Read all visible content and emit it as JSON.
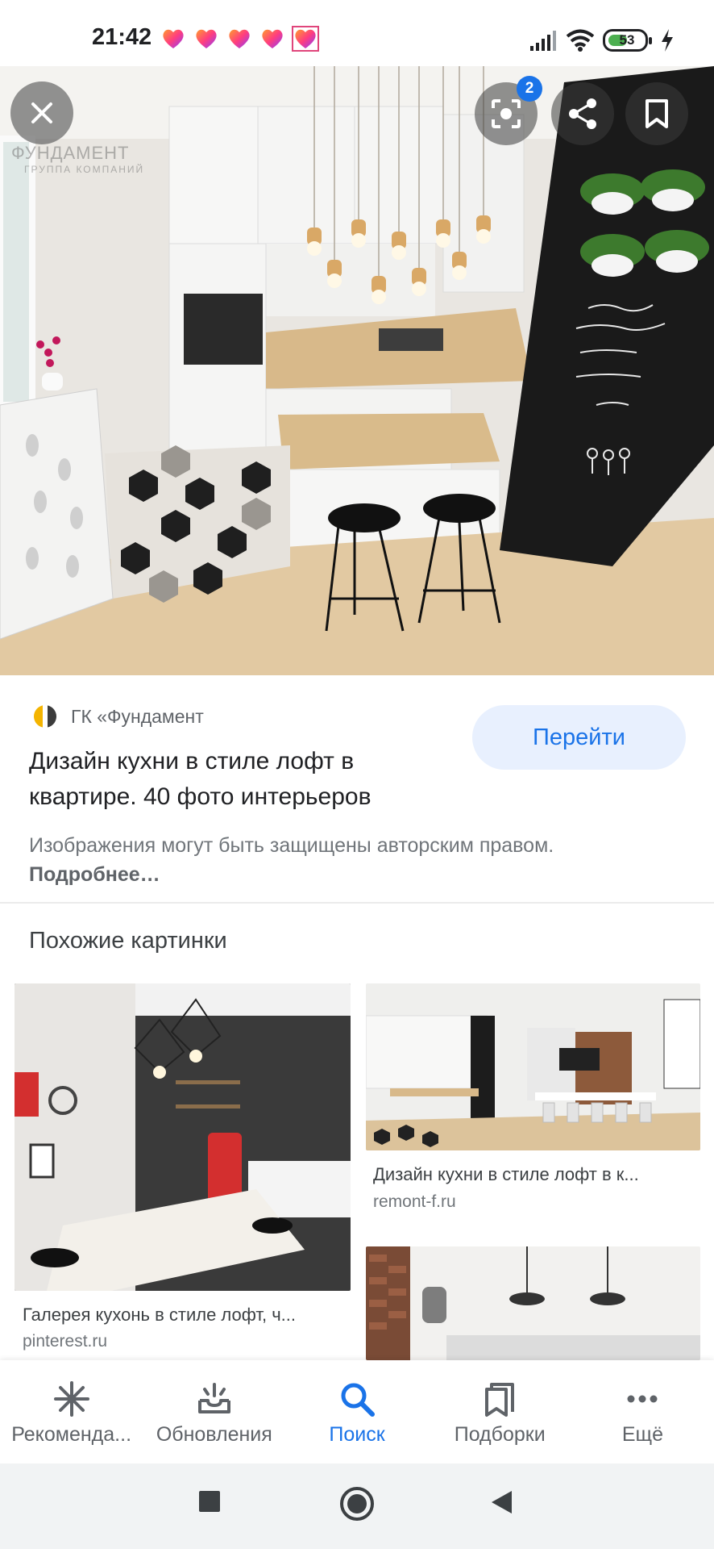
{
  "status_bar": {
    "time": "21:42",
    "battery": "53",
    "battery_level": 0.53,
    "icons": [
      "signal-icon",
      "wifi-icon",
      "battery-icon",
      "charging-icon"
    ]
  },
  "hero": {
    "watermark": "ФУНДАМЕНТ",
    "watermark_sub": "ГРУППА КОМПАНИЙ",
    "lens_badge": "2"
  },
  "result": {
    "source_name": "ГК «Фундамент",
    "title": "Дизайн кухни в стиле лофт в квартире. 40 фото интерьеров",
    "visit_label": "Перейти",
    "copyright_text": "Изображения могут быть защищены авторским правом.",
    "copyright_more": "Подробнее…"
  },
  "related": {
    "title": "Похожие картинки",
    "cards": [
      {
        "caption": "Галерея кухонь в стиле лофт, ч...",
        "domain": "pinterest.ru"
      },
      {
        "caption": "Дизайн кухни в стиле лофт в к...",
        "domain": "remont-f.ru"
      },
      {
        "caption": "",
        "domain": ""
      }
    ]
  },
  "bottom_nav": {
    "items": [
      {
        "label": "Рекоменда...",
        "icon": "asterisk-icon",
        "active": false
      },
      {
        "label": "Обновления",
        "icon": "inbox-icon",
        "active": false
      },
      {
        "label": "Поиск",
        "icon": "search-icon",
        "active": true
      },
      {
        "label": "Подборки",
        "icon": "collections-icon",
        "active": false
      },
      {
        "label": "Ещё",
        "icon": "more-icon",
        "active": false
      }
    ]
  },
  "colors": {
    "accent": "#1a73e8",
    "visit_button_bg": "#e8f0fe",
    "text_primary": "#202124",
    "text_secondary": "#70757a"
  }
}
